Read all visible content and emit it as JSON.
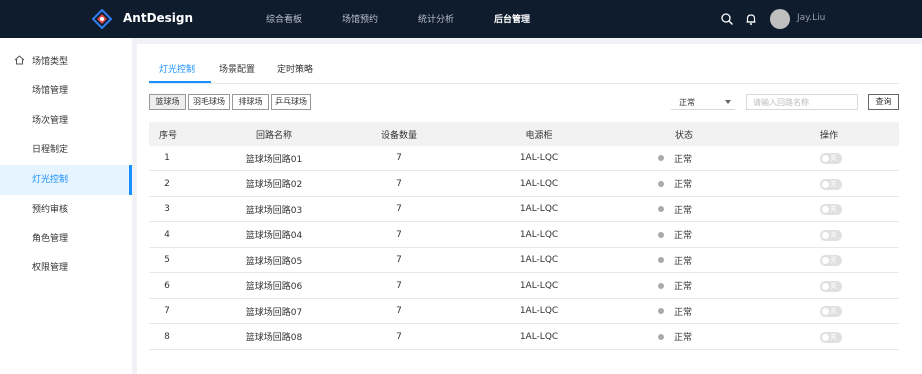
{
  "app": {
    "name": "AntDesign",
    "user": "Jay.Liu"
  },
  "nav": [
    {
      "label": "综合看板",
      "active": false
    },
    {
      "label": "场馆预约",
      "active": false
    },
    {
      "label": "统计分析",
      "active": false
    },
    {
      "label": "后台管理",
      "active": true
    }
  ],
  "header_icons": [
    "search-icon",
    "bell-icon"
  ],
  "sidebar": {
    "header": {
      "label": "场馆类型",
      "icon": "home-icon"
    },
    "items": [
      {
        "label": "场馆管理"
      },
      {
        "label": "场次管理"
      },
      {
        "label": "日程制定"
      },
      {
        "label": "灯光控制",
        "active": true
      },
      {
        "label": "预约审核"
      },
      {
        "label": "角色管理"
      },
      {
        "label": "权限管理"
      }
    ]
  },
  "tabs": [
    {
      "label": "灯光控制",
      "active": true
    },
    {
      "label": "场景配置"
    },
    {
      "label": "定时策略"
    }
  ],
  "venues": [
    {
      "label": "篮球场",
      "selected": true
    },
    {
      "label": "羽毛球场"
    },
    {
      "label": "排球场"
    },
    {
      "label": "乒乓球场"
    }
  ],
  "filter": {
    "status_value": "正常",
    "search_placeholder": "请输入回路名称",
    "query_label": "查询"
  },
  "table": {
    "columns": [
      "序号",
      "回路名称",
      "设备数量",
      "电源柜",
      "状态",
      "操作"
    ],
    "rows": [
      {
        "no": "1",
        "name": "篮球场回路01",
        "count": "7",
        "cabinet": "1AL-LQC",
        "status": "正常",
        "switch": "关"
      },
      {
        "no": "2",
        "name": "篮球场回路02",
        "count": "7",
        "cabinet": "1AL-LQC",
        "status": "正常",
        "switch": "关"
      },
      {
        "no": "3",
        "name": "篮球场回路03",
        "count": "7",
        "cabinet": "1AL-LQC",
        "status": "正常",
        "switch": "关"
      },
      {
        "no": "4",
        "name": "篮球场回路04",
        "count": "7",
        "cabinet": "1AL-LQC",
        "status": "正常",
        "switch": "关"
      },
      {
        "no": "5",
        "name": "篮球场回路05",
        "count": "7",
        "cabinet": "1AL-LQC",
        "status": "正常",
        "switch": "关"
      },
      {
        "no": "6",
        "name": "篮球场回路06",
        "count": "7",
        "cabinet": "1AL-LQC",
        "status": "正常",
        "switch": "关"
      },
      {
        "no": "7",
        "name": "篮球场回路07",
        "count": "7",
        "cabinet": "1AL-LQC",
        "status": "正常",
        "switch": "关"
      },
      {
        "no": "8",
        "name": "篮球场回路08",
        "count": "7",
        "cabinet": "1AL-LQC",
        "status": "正常",
        "switch": "关"
      }
    ]
  },
  "colors": {
    "accent": "#1890ff",
    "topbar": "#0f1c2e",
    "status_dot": "#aaaaaa",
    "switch_off": "#e0e0e0"
  }
}
